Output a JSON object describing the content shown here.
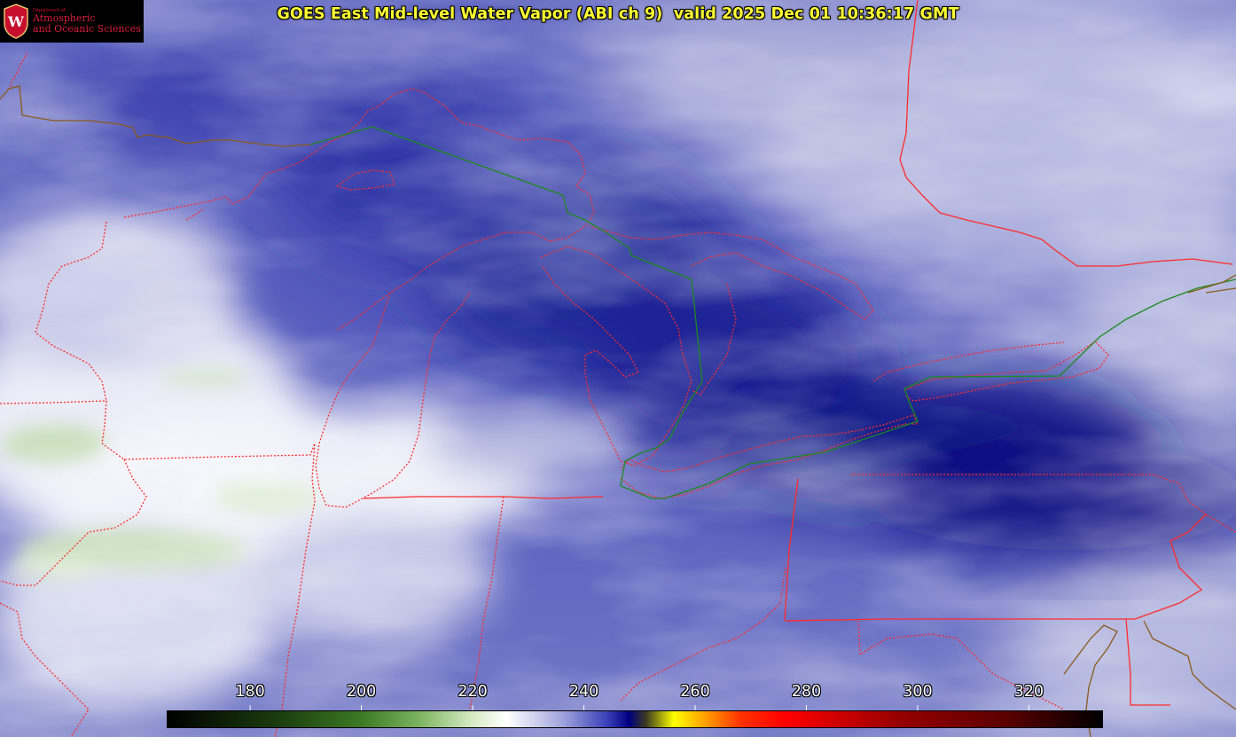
{
  "title": "GOES East Mid-level Water Vapor (ABI ch 9)  valid 2025 Dec 01 10:36:17 GMT",
  "logo": {
    "department_line": "Department of",
    "line1": "Atmospheric",
    "line2": "and Oceanic Sciences",
    "seal_letter": "W"
  },
  "colorbar": {
    "ticks": [
      "180",
      "200",
      "220",
      "240",
      "260",
      "280",
      "300",
      "320"
    ],
    "tick_values": [
      180,
      200,
      220,
      240,
      260,
      280,
      300,
      320
    ],
    "range": [
      165,
      333
    ],
    "stops": [
      {
        "v": 165,
        "color": "#000000"
      },
      {
        "v": 185,
        "color": "#1b3d0e"
      },
      {
        "v": 200,
        "color": "#3c7a24"
      },
      {
        "v": 210,
        "color": "#7bb35d"
      },
      {
        "v": 220,
        "color": "#d8ecc7"
      },
      {
        "v": 226,
        "color": "#ffffff"
      },
      {
        "v": 236,
        "color": "#a0a4dd"
      },
      {
        "v": 244,
        "color": "#3a40b8"
      },
      {
        "v": 248,
        "color": "#000080"
      },
      {
        "v": 251,
        "color": "#3a3a20"
      },
      {
        "v": 256,
        "color": "#ffff00"
      },
      {
        "v": 262,
        "color": "#ff9900"
      },
      {
        "v": 268,
        "color": "#ff3300"
      },
      {
        "v": 276,
        "color": "#ff0000"
      },
      {
        "v": 296,
        "color": "#990000"
      },
      {
        "v": 316,
        "color": "#5a0000"
      },
      {
        "v": 333,
        "color": "#000000"
      }
    ]
  },
  "colors": {
    "state_borders": "#ff2020",
    "international_border": "#1a8a1a",
    "coastlines": "#8a5a1a",
    "title_text": "#ffff33"
  }
}
